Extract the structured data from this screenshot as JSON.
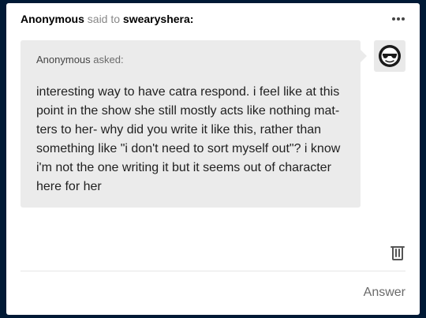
{
  "header": {
    "sender": "Anonymous",
    "said_to": "said to",
    "recipient": "swearyshera:"
  },
  "ask": {
    "asker": "Anonymous",
    "asked_label": "asked:",
    "question": "interesting way to have catra respond. i feel like at this\npoint in the show she still mostly acts like nothing mat-\nters to her- why did you write it like this, rather than\nsomething like \"i don't need to sort myself out\"? i know\ni'm not the one writing it but it seems out of character\nhere for her"
  },
  "icons": {
    "menu": "more-horizontal-icon",
    "avatar": "sunglasses-face-icon",
    "delete": "trash-icon"
  },
  "footer": {
    "answer_label": "Answer"
  },
  "colors": {
    "page_background": "#001935",
    "bubble": "#ebebeb"
  }
}
